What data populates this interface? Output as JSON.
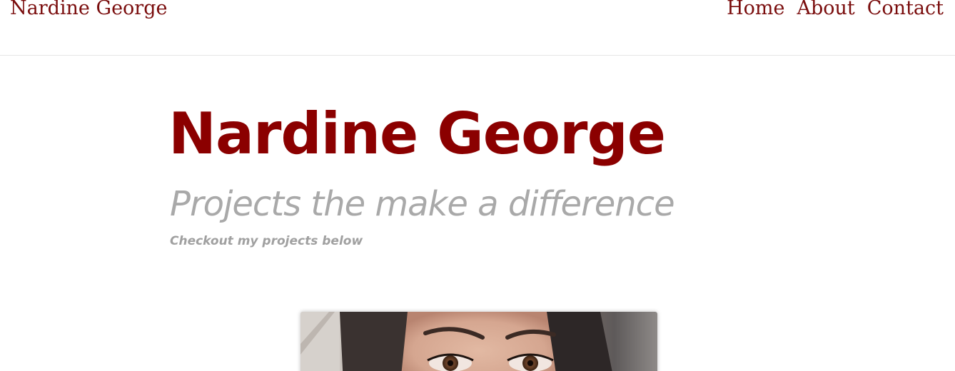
{
  "navbar": {
    "brand": "Nardine George",
    "links": [
      "Home",
      "About",
      "Contact"
    ]
  },
  "hero": {
    "title": "Nardine George",
    "subtitle": "Projects the make a difference",
    "tagline": "Checkout my projects below"
  },
  "colors": {
    "brand": "#8b0000",
    "muted": "#a9a9a9"
  }
}
